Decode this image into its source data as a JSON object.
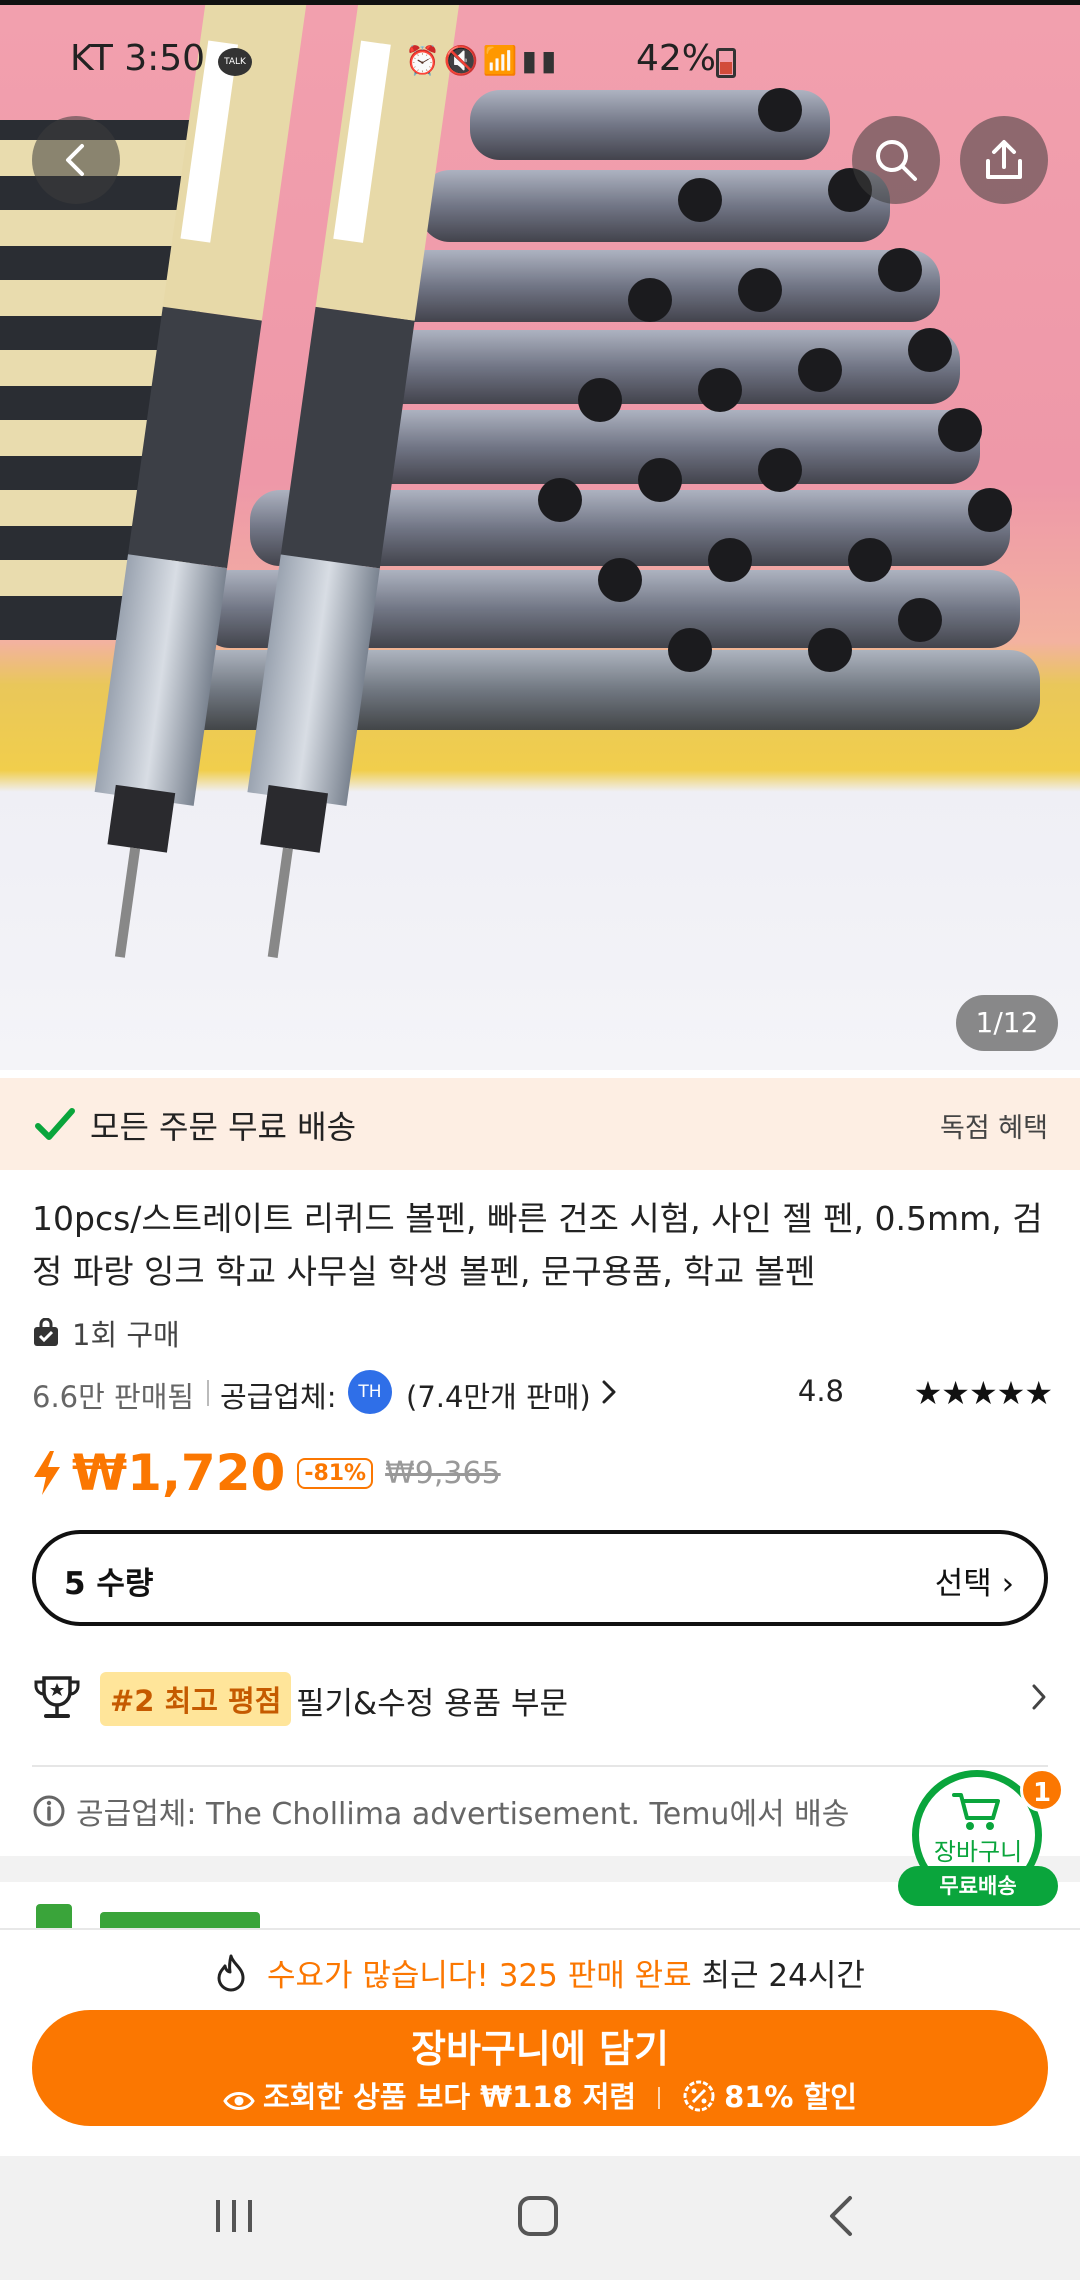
{
  "status_bar": {
    "carrier_time": "KT 3:50",
    "talk_badge": "TALK",
    "battery": "42%"
  },
  "image": {
    "counter": "1/12"
  },
  "shipping_banner": {
    "text": "모든 주문 무료 배송",
    "exclusive": "독점 혜택"
  },
  "product": {
    "title": "10pcs/스트레이트 리퀴드 볼펜, 빠른 건조 시험, 사인 젤 펜, 0.5mm, 검정 파랑 잉크 학교 사무실 학생 볼펜, 문구용품, 학교 볼펜",
    "purchased_before": "1회 구매",
    "sold": "6.6만 판매됨",
    "supplier_label": "공급업체:",
    "supplier_avatar": "TH",
    "supplier_sold": "(7.4만개 판매)",
    "rating": "4.8",
    "stars": 4.8
  },
  "price": {
    "current": "₩1,720",
    "discount": "-81%",
    "original": "₩9,365"
  },
  "quantity": {
    "label": "5 수량",
    "select": "선택"
  },
  "ranking": {
    "badge": "#2 최고 평점",
    "category": "필기&수정 용품 부문"
  },
  "supplier_note": "공급업체: The Chollima advertisement. Temu에서 배송",
  "cart_float": {
    "label": "장바구니",
    "free_shipping": "무료배송",
    "count": "1"
  },
  "bottom": {
    "demand_hot": "수요가 많습니다! 325 판매 완료",
    "demand_recent": "최근 24시간",
    "add_to_cart": "장바구니에 담기",
    "cheaper": "조회한 상품 보다 ₩118 저렴",
    "discount": "81% 할인"
  },
  "colors": {
    "accent": "#fb7701",
    "green": "#0aa53c",
    "banner_bg": "#fdeee3"
  }
}
